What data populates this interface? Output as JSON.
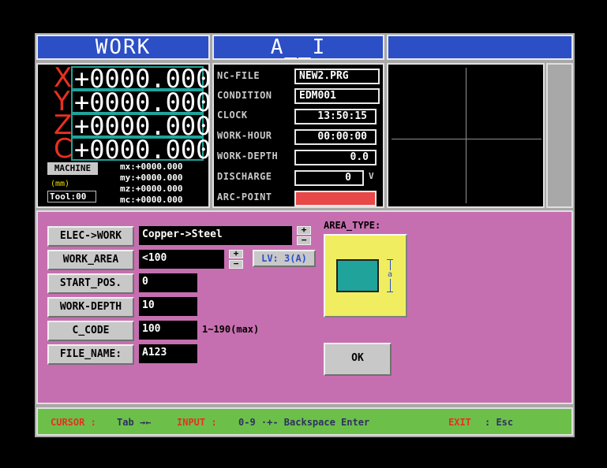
{
  "headers": {
    "work": "WORK",
    "mode": "A__I",
    "right": ""
  },
  "coords": [
    {
      "axis": "X",
      "value": "+0000.000"
    },
    {
      "axis": "Y",
      "value": "+0000.000"
    },
    {
      "axis": "Z",
      "value": "+0000.000"
    },
    {
      "axis": "C",
      "value": "+0000.000"
    }
  ],
  "machine": {
    "label": "MACHINE",
    "unit": "(mm)",
    "tool": "Tool:00",
    "mx": "mx:+0000.000",
    "my": "my:+0000.000",
    "mz": "mz:+0000.000",
    "mc": "mc:+0000.000"
  },
  "status_panel": [
    {
      "label": "NC-FILE",
      "value": "NEW2.PRG"
    },
    {
      "label": "CONDITION",
      "value": "EDM001"
    },
    {
      "label": "CLOCK",
      "value": "13:50:15"
    },
    {
      "label": "WORK-HOUR",
      "value": "00:00:00"
    },
    {
      "label": "WORK-DEPTH",
      "value": "0.0"
    },
    {
      "label": "DISCHARGE",
      "value": "0",
      "unit": "V"
    },
    {
      "label": "ARC-POINT",
      "value": ""
    }
  ],
  "form": {
    "elec_work": {
      "button": "ELEC->WORK",
      "value": "Copper->Steel"
    },
    "work_area": {
      "button": "WORK_AREA",
      "value": "<100",
      "level": "LV: 3(A)"
    },
    "start_pos": {
      "button": "START_POS.",
      "value": "0"
    },
    "work_depth": {
      "button": "WORK-DEPTH",
      "value": "10"
    },
    "c_code": {
      "button": "C_CODE",
      "value": "100",
      "hint": "1~190(max)"
    },
    "file_name": {
      "button": "FILE_NAME:",
      "value": "A123"
    },
    "plus": "+",
    "minus": "−"
  },
  "area_type": {
    "label": "AREA_TYPE:",
    "dim": "a"
  },
  "ok_button": "OK",
  "footer": {
    "cursor_label": "CURSOR :",
    "cursor_keys": "Tab →←",
    "input_label": "INPUT :",
    "input_keys": "0-9 ·+-  Backspace Enter",
    "exit_label": "EXIT",
    "exit_keys": ": Esc"
  },
  "colors": {
    "header_blue": "#2c4fc6",
    "panel_pink": "#c66fb0",
    "status_green": "#6cc04a",
    "axis_red": "#e83020",
    "arc_red": "#e84848"
  }
}
